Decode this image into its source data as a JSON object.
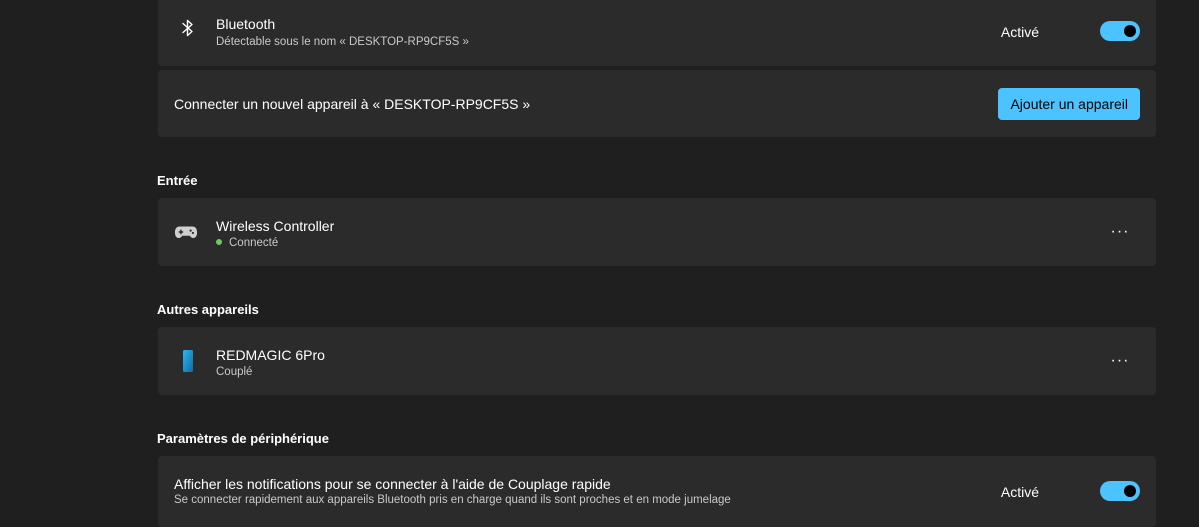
{
  "colors": {
    "background": "#1f1f1f",
    "card": "#2b2b2b",
    "accent": "#4cc2ff",
    "connected_dot": "#6ccb5f"
  },
  "bluetooth": {
    "icon": "bluetooth-icon",
    "title": "Bluetooth",
    "subtitle": "Détectable sous le nom « DESKTOP-RP9CF5S »",
    "status": "Activé",
    "toggle_on": true
  },
  "add_device": {
    "text": "Connecter un nouvel appareil à « DESKTOP-RP9CF5S »",
    "button_label": "Ajouter un appareil"
  },
  "input_section": {
    "header": "Entrée",
    "devices": [
      {
        "icon": "gamepad-icon",
        "name": "Wireless Controller",
        "status": "Connecté",
        "more": "···"
      }
    ]
  },
  "other_section": {
    "header": "Autres appareils",
    "devices": [
      {
        "icon": "phone-icon",
        "name": "REDMAGIC 6Pro",
        "status": "Couplé",
        "more": "···"
      }
    ]
  },
  "settings_section": {
    "header": "Paramètres de périphérique",
    "swift_pair": {
      "title": "Afficher les notifications pour se connecter à l'aide de Couplage rapide",
      "subtitle": "Se connecter rapidement aux appareils Bluetooth pris en charge quand ils sont proches et en mode jumelage",
      "status": "Activé",
      "toggle_on": true
    }
  }
}
